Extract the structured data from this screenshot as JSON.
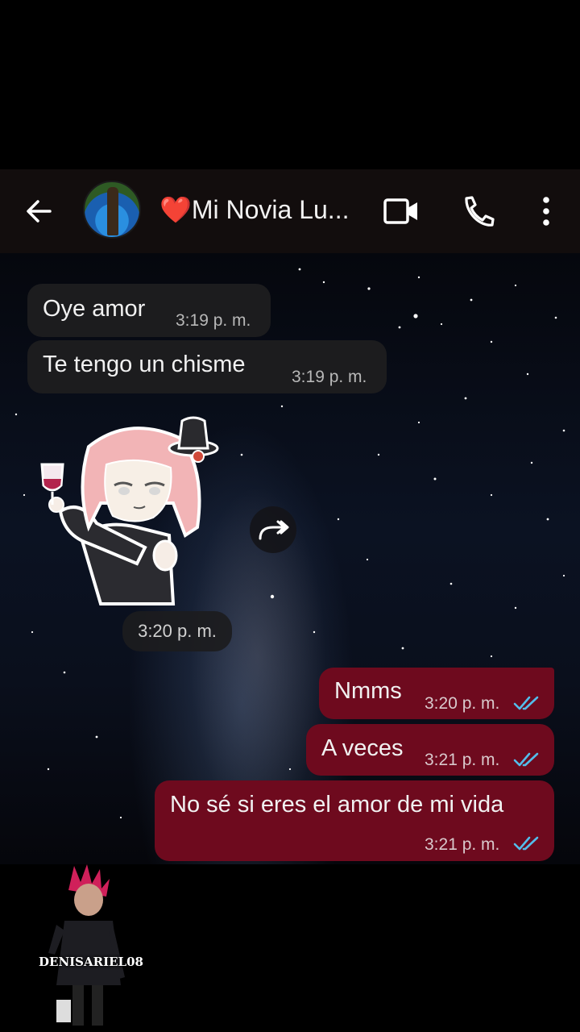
{
  "header": {
    "contact_name": "❤️Mi Novia Lu...",
    "back_icon": "arrow-left-icon",
    "video_icon": "video-camera-icon",
    "call_icon": "phone-icon",
    "menu_icon": "more-vertical-icon"
  },
  "messages": [
    {
      "direction": "incoming",
      "text": "Oye amor",
      "time": "3:19 p. m."
    },
    {
      "direction": "incoming",
      "text": "Te tengo un chisme",
      "time": "3:19 p. m."
    },
    {
      "direction": "incoming",
      "type": "sticker",
      "time": "3:20 p. m."
    },
    {
      "direction": "outgoing",
      "text": "Nmms",
      "time": "3:20 p. m.",
      "status": "read"
    },
    {
      "direction": "outgoing",
      "text": "A veces",
      "time": "3:21 p. m.",
      "status": "read"
    },
    {
      "direction": "outgoing",
      "text": "No sé si eres el amor de mi vida",
      "time": "3:21 p. m.",
      "status": "read"
    }
  ],
  "watermark": {
    "text": "DENISARIEL08"
  },
  "colors": {
    "header_bg": "#120d0d",
    "incoming_bubble": "#1c1c1e",
    "outgoing_bubble": "#6e0a1e",
    "read_ticks": "#53bdeb"
  }
}
